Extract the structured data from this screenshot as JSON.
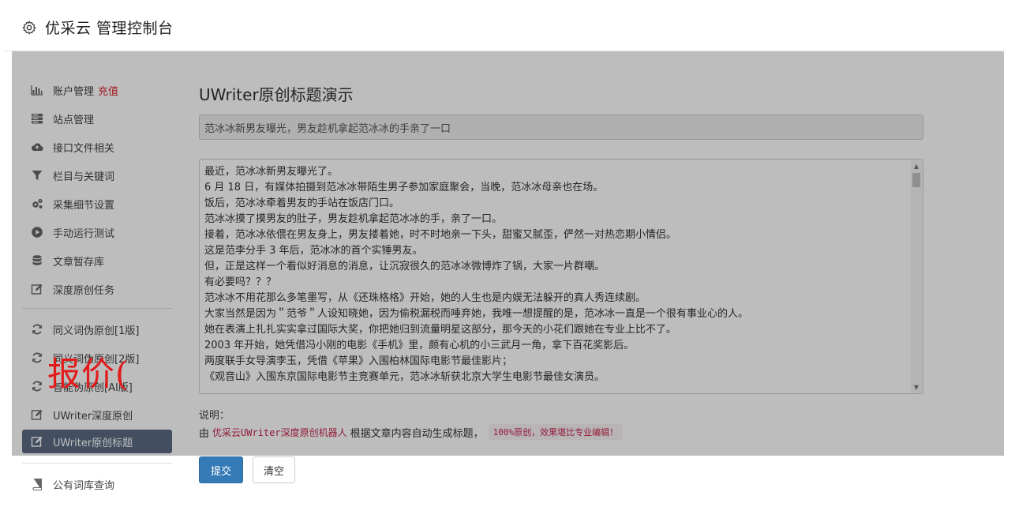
{
  "header": {
    "title": "优采云 管理控制台"
  },
  "sidebar": {
    "items": [
      {
        "label": "账户管理",
        "badge": "充值",
        "icon": "bar-chart-icon"
      },
      {
        "label": "站点管理",
        "icon": "server-icon"
      },
      {
        "label": "接口文件相关",
        "icon": "cloud-upload-icon"
      },
      {
        "label": "栏目与关键词",
        "icon": "filter-icon"
      },
      {
        "label": "采集细节设置",
        "icon": "cogs-icon"
      },
      {
        "label": "手动运行测试",
        "icon": "play-icon"
      },
      {
        "label": "文章暂存库",
        "icon": "database-icon"
      },
      {
        "label": "深度原创任务",
        "icon": "edit-icon"
      },
      {
        "label": "同义词伪原创[1版]",
        "icon": "refresh-icon"
      },
      {
        "label": "同义词伪原创[2版]",
        "icon": "refresh-icon"
      },
      {
        "label": "智能伪原创[AI版]",
        "icon": "refresh-icon"
      },
      {
        "label": "UWriter深度原创",
        "icon": "edit-icon"
      },
      {
        "label": "UWriter原创标题",
        "icon": "edit-icon"
      },
      {
        "label": "公有词库查询",
        "icon": "book-icon"
      }
    ]
  },
  "overlay": {
    "text": "报价("
  },
  "main": {
    "heading": "UWriter原创标题演示",
    "title_value": "范冰冰新男友曝光，男友趁机拿起范冰冰的手亲了一口",
    "article_lines": [
      "最近，范冰冰新男友曝光了。",
      "6 月 18 日，有媒体拍摄到范冰冰带陌生男子参加家庭聚会，当晚，范冰冰母亲也在场。",
      "饭后，范冰冰牵着男友的手站在饭店门口。",
      "范冰冰摸了摸男友的肚子，男友趁机拿起范冰冰的手，亲了一口。",
      "接着，范冰冰依偎在男友身上，男友搂着她，时不时地亲一下头，甜蜜又腻歪，俨然一对热恋期小情侣。",
      "这是范李分手 3 年后，范冰冰的首个实锤男友。",
      "但，正是这样一个看似好消息的消息，让沉寂很久的范冰冰微博炸了锅，大家一片群嘲。",
      "有必要吗？？？",
      "范冰冰不用花那么多笔墨写，从《还珠格格》开始，她的人生也是内娱无法躲开的真人秀连续剧。",
      "大家当然是因为＂范爷＂人设知晓她，因为偷税漏税而唾弃她，我唯一想提醒的是，范冰冰一直是一个很有事业心的人。",
      "她在表演上扎扎实实拿过国际大奖，你把她归到流量明星这部分，那今天的小花们跟她在专业上比不了。",
      "2003 年开始，她凭借冯小刚的电影《手机》里，颇有心机的小三武月一角，拿下百花奖影后。",
      "两度联手女导演李玉，凭借《苹果》入围柏林国际电影节最佳影片；",
      "《观音山》入围东京国际电影节主竞赛单元，范冰冰斩获北京大学生电影节最佳女演员。"
    ],
    "desc_label": "说明：",
    "desc_prefix": "由",
    "desc_robot": "优采云UWriter深度原创机器人",
    "desc_middle": "根据文章内容自动生成标题，",
    "desc_pill": "100%原创，效果堪比专业编辑！",
    "submit_label": "提交",
    "clear_label": "清空"
  },
  "colors": {
    "accent_red": "#d9252e",
    "active_nav": "#5b6b84",
    "primary_button": "#337ab7"
  }
}
